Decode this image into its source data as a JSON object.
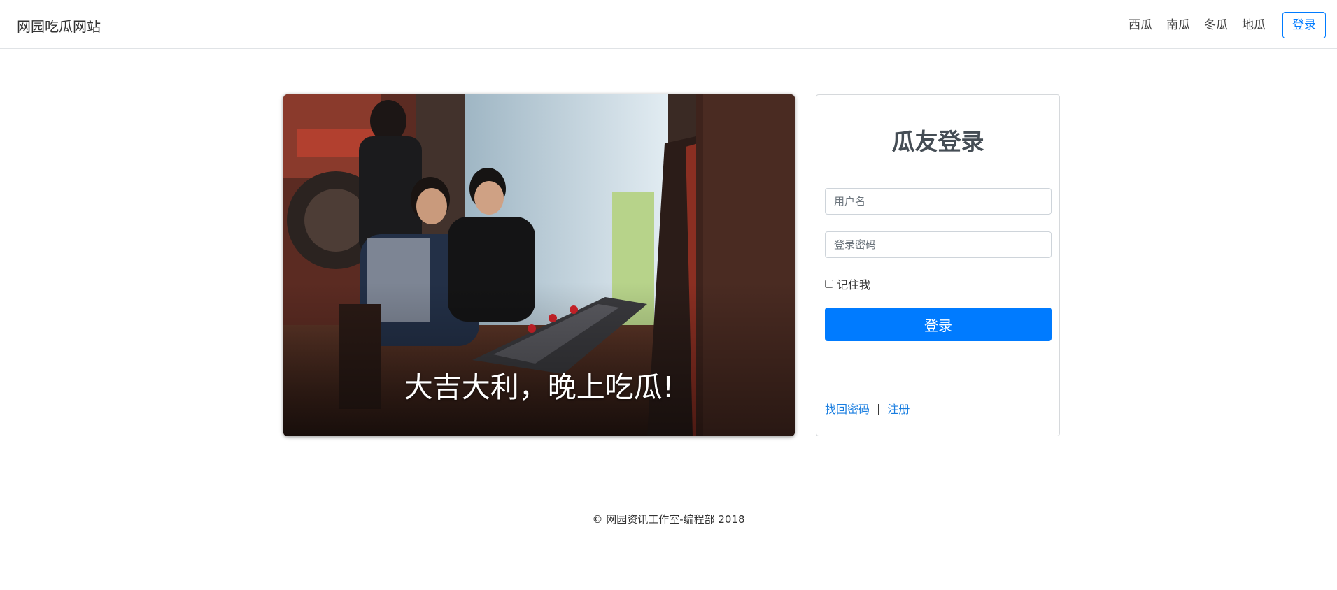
{
  "navbar": {
    "brand": "网园吃瓜网站",
    "links": [
      "西瓜",
      "南瓜",
      "冬瓜",
      "地瓜"
    ],
    "login_label": "登录",
    "accent_color": "#007bff"
  },
  "hero": {
    "caption": "大吉大利，晚上吃瓜!"
  },
  "login_card": {
    "title": "瓜友登录",
    "username_placeholder": "用户名",
    "password_placeholder": "登录密码",
    "remember_label": "记住我",
    "submit_label": "登录",
    "forgot_link": "找回密码",
    "separator": "|",
    "register_link": "注册"
  },
  "footer": {
    "copyright": "© 网园资讯工作室-编程部 2018"
  }
}
